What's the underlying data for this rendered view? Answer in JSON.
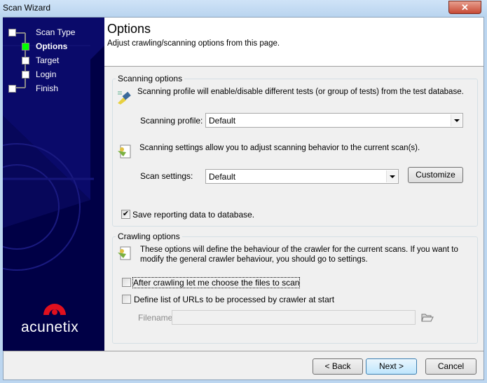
{
  "window": {
    "title": "Scan Wizard",
    "close_label": "✕"
  },
  "sidebar": {
    "steps": [
      {
        "label": "Scan Type"
      },
      {
        "label": "Options",
        "active": true
      },
      {
        "label": "Target"
      },
      {
        "label": "Login"
      },
      {
        "label": "Finish"
      }
    ],
    "logo_text": "acunetix",
    "active_color": "#00ff00"
  },
  "header": {
    "title": "Options",
    "subtitle": "Adjust crawling/scanning options from this page."
  },
  "scanning": {
    "legend": "Scanning options",
    "profile_desc": "Scanning profile will enable/disable different tests (or group of tests) from the test database.",
    "profile_label": "Scanning profile:",
    "profile_value": "Default",
    "settings_desc": "Scanning settings allow you to adjust scanning behavior to the current scan(s).",
    "settings_label": "Scan settings:",
    "settings_value": "Default",
    "customize": "Customize",
    "save_reporting": "Save reporting data to database.",
    "save_checked": true
  },
  "crawling": {
    "legend": "Crawling options",
    "desc": "These options will define the behaviour of the crawler for the current scans. If you want to modify the general crawler behaviour, you should go to settings.",
    "after_crawl": "After crawling let me choose the files to scan",
    "define_list": "Define list of URLs to be processed by crawler at start",
    "filename_label": "Filename:",
    "filename_value": ""
  },
  "footer": {
    "back": "< Back",
    "next": "Next >",
    "cancel": "Cancel"
  }
}
